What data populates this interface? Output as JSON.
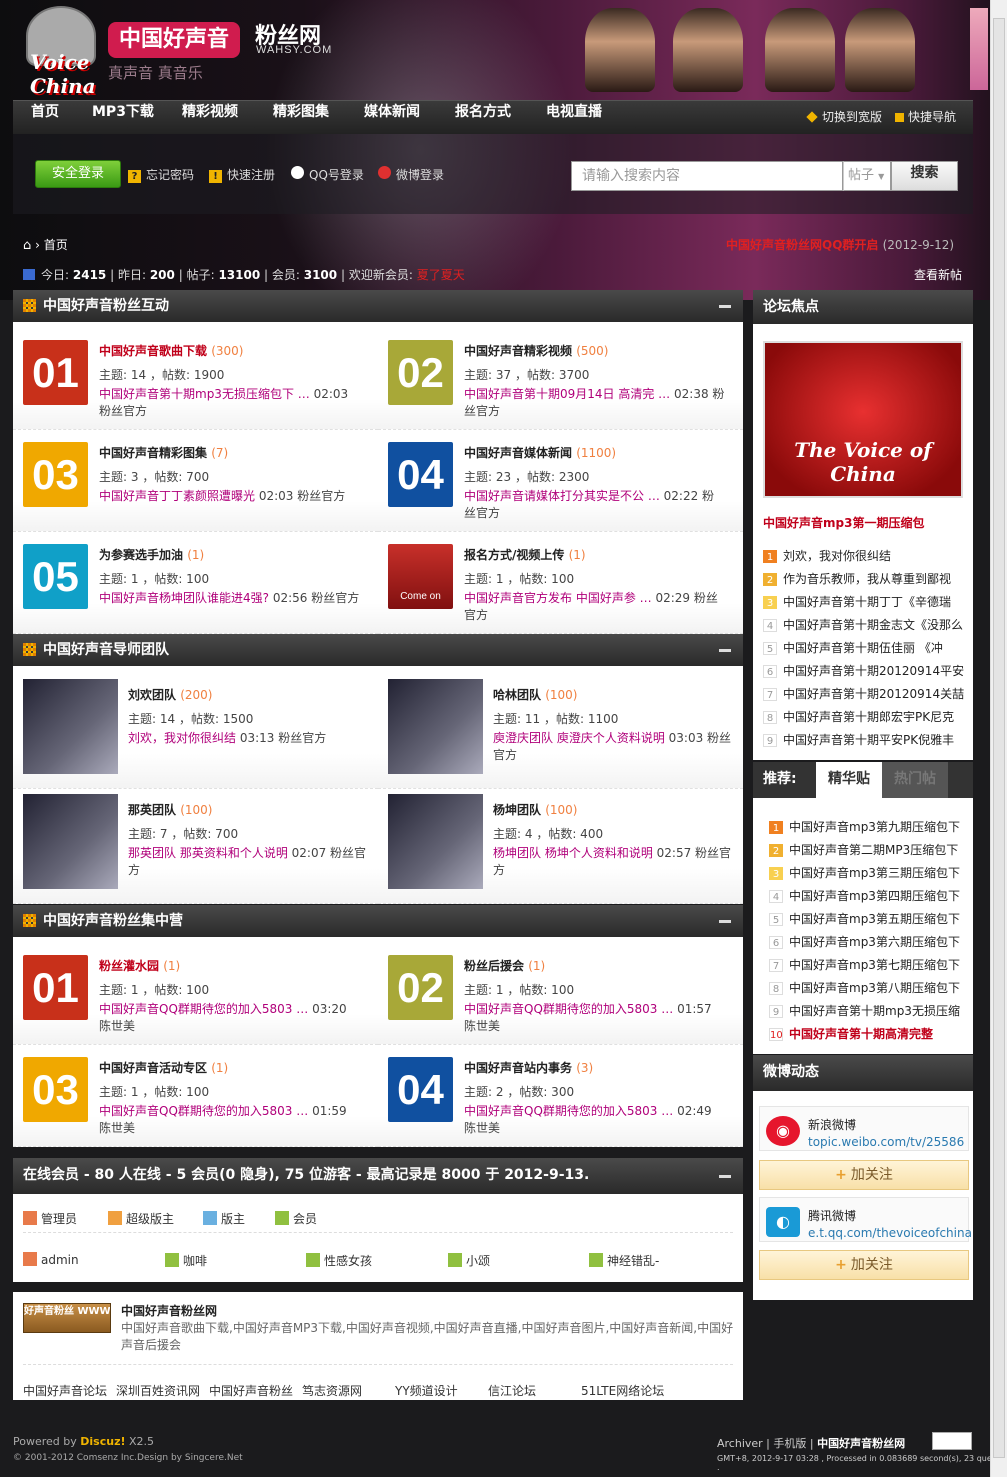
{
  "header": {
    "logo_text": "Voice China",
    "brand": "中国好声音",
    "brand2": "粉丝网",
    "domain": "WAHSY.COM",
    "slogan": "真声音 真音乐"
  },
  "nav": {
    "items": [
      "首页",
      "MP3下载",
      "精彩视频",
      "精彩图集",
      "媒体新闻",
      "报名方式",
      "电视直播"
    ],
    "wide": "切换到宽版",
    "quick": "快捷导航"
  },
  "login": {
    "safe_login": "安全登录",
    "forgot": "忘记密码",
    "register": "快速注册",
    "qq": "QQ号登录",
    "weibo": "微博登录",
    "search_placeholder": "请输入搜索内容",
    "search_type": "帖子",
    "search_btn": "搜索"
  },
  "crumb": {
    "home": "首页"
  },
  "notice": {
    "text": "中国好声音粉丝网QQ群开启",
    "date": "(2012-9-12)"
  },
  "stats": {
    "today_label": "今日:",
    "today": "2415",
    "yesterday_label": "昨日:",
    "yesterday": "200",
    "posts_label": "帖子:",
    "posts": "13100",
    "members_label": "会员:",
    "members": "3100",
    "welcome": "欢迎新会员:",
    "newuser": "夏了夏天",
    "newposts": "查看新帖"
  },
  "sections": [
    {
      "title": "中国好声音粉丝互动",
      "cells": [
        {
          "badge": "01",
          "title": "中国好声音歌曲下载",
          "count": "(300)",
          "topics": "主题: 14",
          "posts": "帖数: 1900",
          "last": "中国好声音第十期mp3无损压缩包下 …",
          "time": "02:03 粉丝官方"
        },
        {
          "badge": "02",
          "title": "中国好声音精彩视频",
          "count": "(500)",
          "topics": "主题: 37",
          "posts": "帖数: 3700",
          "last": "中国好声音第十期09月14日 高清完 …",
          "time": "02:38 粉丝官方"
        },
        {
          "badge": "03",
          "title": "中国好声音精彩图集",
          "count": "(7)",
          "topics": "主题: 3",
          "posts": "帖数: 700",
          "last": "中国好声音丁丁素颜照遭曝光",
          "time": "02:03 粉丝官方"
        },
        {
          "badge": "04",
          "title": "中国好声音媒体新闻",
          "count": "(1100)",
          "topics": "主题: 23",
          "posts": "帖数: 2300",
          "last": "中国好声音请媒体打分其实是不公 …",
          "time": "02:22 粉丝官方"
        },
        {
          "badge": "05",
          "title": "为参赛选手加油",
          "count": "(1)",
          "topics": "主题: 1",
          "posts": "帖数: 100",
          "last": "中国好声音杨坤团队谁能进4强?",
          "time": "02:56 粉丝官方"
        },
        {
          "badge": "Come on",
          "title": "报名方式/视频上传",
          "count": "(1)",
          "topics": "主题: 1",
          "posts": "帖数: 100",
          "last": "中国好声音官方发布 中国好声参 …",
          "time": "02:29 粉丝官方"
        }
      ]
    },
    {
      "title": "中国好声音导师团队",
      "cells": [
        {
          "title": "刘欢团队",
          "count": "(200)",
          "topics": "主题: 14",
          "posts": "帖数: 1500",
          "last": "刘欢，我对你很纠结",
          "time": "03:13 粉丝官方"
        },
        {
          "title": "哈林团队",
          "count": "(100)",
          "topics": "主题: 11",
          "posts": "帖数: 1100",
          "last": "庾澄庆团队 庾澄庆个人资料说明",
          "time": "03:03 粉丝官方"
        },
        {
          "title": "那英团队",
          "count": "(100)",
          "topics": "主题: 7",
          "posts": "帖数: 700",
          "last": "那英团队 那英资料和个人说明",
          "time": "02:07 粉丝官方"
        },
        {
          "title": "杨坤团队",
          "count": "(100)",
          "topics": "主题: 4",
          "posts": "帖数: 400",
          "last": "杨坤团队 杨坤个人资料和说明",
          "time": "02:57 粉丝官方"
        }
      ]
    },
    {
      "title": "中国好声音粉丝集中营",
      "cells": [
        {
          "badge": "01",
          "title": "粉丝灌水园",
          "count": "(1)",
          "topics": "主题: 1",
          "posts": "帖数: 100",
          "last": "中国好声音QQ群期待您的加入5803 …",
          "time": "03:20 陈世美"
        },
        {
          "badge": "02",
          "title": "粉丝后援会",
          "count": "(1)",
          "topics": "主题: 1",
          "posts": "帖数: 100",
          "last": "中国好声音QQ群期待您的加入5803 …",
          "time": "01:57 陈世美"
        },
        {
          "badge": "03",
          "title": "中国好声音活动专区",
          "count": "(1)",
          "topics": "主题: 1",
          "posts": "帖数: 100",
          "last": "中国好声音QQ群期待您的加入5803 …",
          "time": "01:59 陈世美"
        },
        {
          "badge": "04",
          "title": "中国好声音站内事务",
          "count": "(3)",
          "topics": "主题: 2",
          "posts": "帖数: 300",
          "last": "中国好声音QQ群期待您的加入5803 …",
          "time": "02:49 陈世美"
        }
      ]
    }
  ],
  "online": {
    "title": "在线会员 - 80 人在线 - 5 会员(0 隐身), 75 位游客 - 最高记录是 8000 于 2012-9-13.",
    "legend": [
      "管理员",
      "超级版主",
      "版主",
      "会员"
    ],
    "users": [
      "admin",
      "咖啡",
      "性感女孩",
      "小颂",
      "神经错乱-"
    ]
  },
  "site": {
    "logo": "好声音粉丝 WWW.WAHSY.COM",
    "title": "中国好声音粉丝网",
    "desc": "中国好声音歌曲下载,中国好声音MP3下载,中国好声音视频,中国好声音直播,中国好声音图片,中国好声音新闻,中国好声音后援会",
    "links": [
      "中国好声音论坛",
      "深圳百姓资讯网",
      "中国好声音粉丝",
      "笃志资源网",
      "YY频道设计",
      "信江论坛",
      "51LTE网络论坛"
    ]
  },
  "focus": {
    "title": "论坛焦点",
    "img_label": "The Voice of China",
    "caption": "中国好声音mp3第一期压缩包",
    "items": [
      "刘欢，我对你很纠结",
      "作为音乐教师，我从尊重到鄙视",
      "中国好声音第十期丁丁《辛德瑞",
      "中国好声音第十期金志文《没那么",
      "中国好声音第十期伍佳丽 《冲",
      "中国好声音第十期20120914平安",
      "中国好声音第十期20120914关喆",
      "中国好声音第十期郎宏宇PK尼克",
      "中国好声音第十期平安PK倪雅丰"
    ]
  },
  "recommend": {
    "label": "推荐:",
    "tab1": "精华贴",
    "tab2": "热门帖",
    "items": [
      "中国好声音mp3第九期压缩包下",
      "中国好声音第二期MP3压缩包下",
      "中国好声音mp3第三期压缩包下",
      "中国好声音mp3第四期压缩包下",
      "中国好声音mp3第五期压缩包下",
      "中国好声音mp3第六期压缩包下",
      "中国好声音mp3第七期压缩包下",
      "中国好声音mp3第八期压缩包下",
      "中国好声音第十期mp3无损压缩",
      "中国好声音第十期高清完整"
    ]
  },
  "weibo": {
    "title": "微博动态",
    "sina_name": "新浪微博",
    "sina_url": "topic.weibo.com/tv/25586",
    "tx_name": "腾讯微博",
    "tx_url": "e.t.qq.com/thevoiceofchina",
    "follow": "加关注"
  },
  "footer": {
    "powered": "Powered by",
    "brand": "Discuz!",
    "ver": "X2.5",
    "copy": "© 2001-2012 Comsenz Inc.Design by Singcere.Net",
    "links": "Archiver | 手机版 | ",
    "site": "中国好声音粉丝网",
    "gmt": "GMT+8, 2012-9-17 03:28 , Processed in 0.083689 second(s), 23 queries ."
  }
}
